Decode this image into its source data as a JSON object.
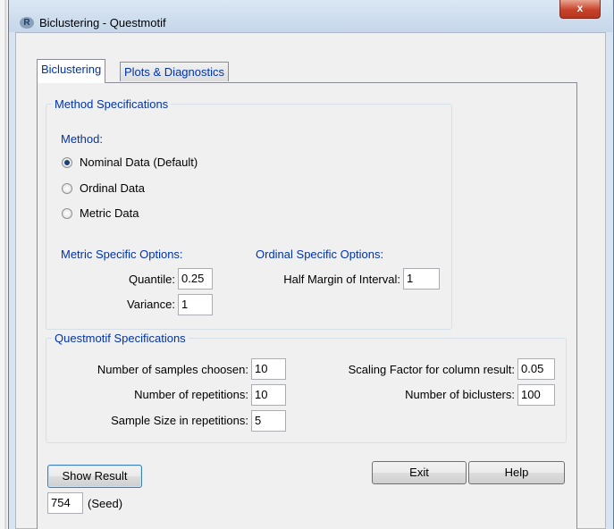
{
  "window": {
    "title": "Biclustering - Questmotif",
    "app_icon": "R",
    "close_label": "x"
  },
  "tabs": [
    {
      "label": "Biclustering",
      "active": true
    },
    {
      "label": "Plots & Diagnostics",
      "active": false
    }
  ],
  "method_specs": {
    "legend": "Method Specifications",
    "method_label": "Method:",
    "options": [
      {
        "label": "Nominal Data (Default)",
        "selected": true
      },
      {
        "label": "Ordinal Data",
        "selected": false
      },
      {
        "label": "Metric Data",
        "selected": false
      }
    ],
    "metric_heading": "Metric Specific Options:",
    "ordinal_heading": "Ordinal Specific Options:",
    "quantile_label": "Quantile:",
    "quantile_value": "0.25",
    "variance_label": "Variance:",
    "variance_value": "1",
    "half_margin_label": "Half Margin of Interval:",
    "half_margin_value": "1"
  },
  "questmotif_specs": {
    "legend": "Questmotif Specifications",
    "samples_label": "Number of samples choosen:",
    "samples_value": "10",
    "repetitions_label": "Number of repetitions:",
    "repetitions_value": "10",
    "sample_size_label": "Sample Size in repetitions:",
    "sample_size_value": "5",
    "scaling_label": "Scaling Factor for column result:",
    "scaling_value": "0.05",
    "biclusters_label": "Number of biclusters:",
    "biclusters_value": "100"
  },
  "actions": {
    "show_result": "Show Result",
    "exit": "Exit",
    "help": "Help",
    "seed_value": "754",
    "seed_label": "(Seed)"
  },
  "colors": {
    "accent_text": "#0033aa",
    "selected_radio": "#1c3f7a",
    "close_button": "#c7432a"
  }
}
